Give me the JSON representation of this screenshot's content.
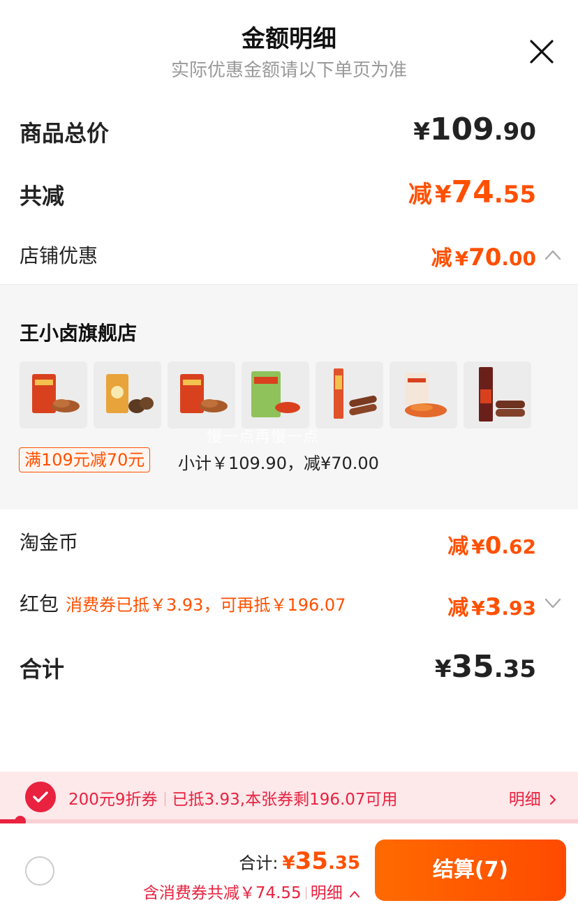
{
  "header": {
    "title": "金额明细",
    "subtitle": "实际优惠金额请以下单页为准"
  },
  "summary": {
    "goods_total_label": "商品总价",
    "goods_total_symbol": "¥",
    "goods_total_int": "109",
    "goods_total_dec": ".90",
    "total_reduce_label": "共减",
    "total_reduce_prefix": "减",
    "total_reduce_symbol": "¥",
    "total_reduce_int": "74",
    "total_reduce_dec": ".55",
    "shop_discount_label": "店铺优惠",
    "shop_discount_prefix": "减",
    "shop_discount_symbol": "¥",
    "shop_discount_int": "70",
    "shop_discount_dec": ".00"
  },
  "shop": {
    "name": "王小卤旗舰店",
    "watermark": "慢一点再慢一点",
    "products": [
      {
        "name": "product-1"
      },
      {
        "name": "product-2"
      },
      {
        "name": "product-3"
      },
      {
        "name": "product-4"
      },
      {
        "name": "product-5"
      },
      {
        "name": "product-6"
      },
      {
        "name": "product-7"
      }
    ],
    "promo_tag": "满109元减70元",
    "subtotal_text": "小计￥109.90，减¥70.00"
  },
  "taojinbi": {
    "label": "淘金币",
    "prefix": "减",
    "symbol": "¥",
    "int": "0",
    "dec": ".62"
  },
  "hongbao": {
    "label": "红包",
    "note": "消费券已抵￥3.93，可再抵￥196.07",
    "prefix": "减",
    "symbol": "¥",
    "int": "3",
    "dec": ".93"
  },
  "total": {
    "label": "合计",
    "symbol": "¥",
    "int": "35",
    "dec": ".35"
  },
  "coupon_bar": {
    "name": "200元9折券",
    "status": "已抵3.93,本张券剩196.07可用",
    "detail": "明细",
    "used_fraction": 0.03
  },
  "footer": {
    "total_label": "合计:",
    "total_symbol": "¥",
    "total_int": "35",
    "total_dec": ".35",
    "saving_text": "含消费券共减￥74.55",
    "detail_label": "明细",
    "checkout_label": "结算(7)"
  },
  "colors": {
    "accent": "#ff5000",
    "coupon_red": "#e8223f",
    "coupon_bg": "#fde8ea",
    "panel_bg": "#f6f6f6"
  }
}
